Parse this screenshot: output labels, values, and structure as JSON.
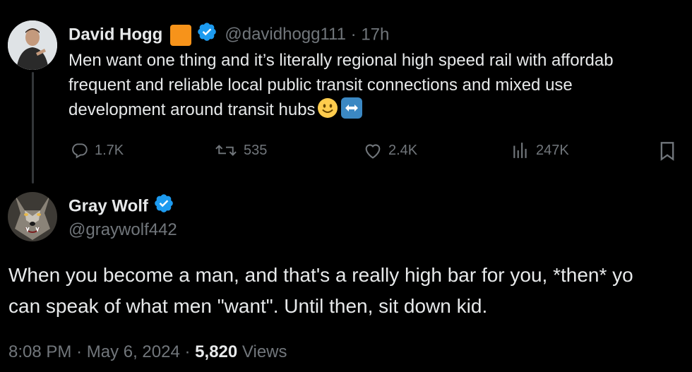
{
  "tweet1": {
    "display_name": "David Hogg",
    "handle": "@davidhogg111",
    "separator": "·",
    "time": "17h",
    "text_lines": [
      "Men want one thing and it’s literally regional high speed rail with affordab",
      "frequent and reliable local public transit connections and mixed use",
      "development around transit hubs"
    ],
    "emojis": [
      "slightly-smiling-face",
      "left-right-arrow"
    ],
    "actions": {
      "replies": "1.7K",
      "retweets": "535",
      "likes": "2.4K",
      "views": "247K"
    },
    "icons": {
      "org_badge": "orange-square-badge",
      "verified": "verified-badge-icon"
    },
    "colors": {
      "org_badge": "#f7931a",
      "verified": "#1d9bf0"
    }
  },
  "tweet2": {
    "display_name": "Gray Wolf",
    "handle": "@graywolf442",
    "text_lines": [
      "When you become a man, and that's a really high bar for you, *then* yo",
      "can speak of what men \"want\". Until then, sit down kid."
    ],
    "meta": {
      "time": "8:08 PM",
      "sep1": "·",
      "date": "May 6, 2024",
      "sep2": "·",
      "views_count": "5,820",
      "views_label": "Views"
    }
  },
  "theme": {
    "background": "#000000",
    "text": "#e7e9ea",
    "muted": "#71767b",
    "line": "#333639"
  }
}
